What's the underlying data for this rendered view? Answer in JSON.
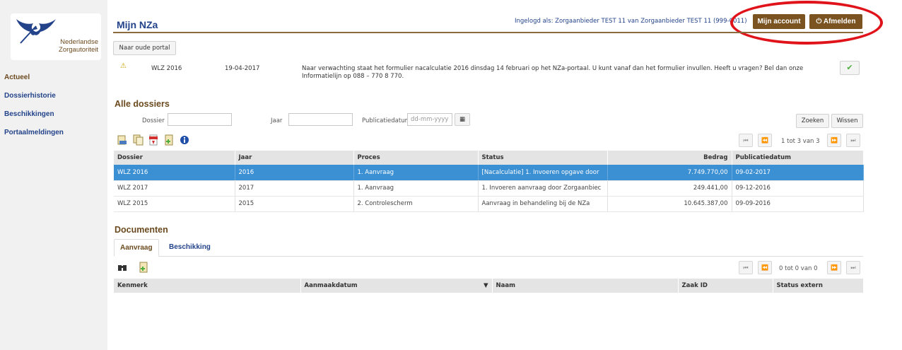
{
  "brand": {
    "line1": "Nederlandse",
    "line2": "Zorgautoriteit"
  },
  "sidebar": {
    "items": [
      {
        "label": "Actueel"
      },
      {
        "label": "Dossierhistorie"
      },
      {
        "label": "Beschikkingen"
      },
      {
        "label": "Portaalmeldingen"
      }
    ]
  },
  "header": {
    "title": "Mijn NZa",
    "logged_in": "Ingelogd als: Zorgaanbieder TEST 11 van Zorgaanbieder TEST 11 (999-0011)",
    "account_label": "Mijn account",
    "logout_label": "Afmelden",
    "old_portal_label": "Naar oude portal"
  },
  "notice": {
    "dossier": "WLZ 2016",
    "date": "19-04-2017",
    "text": "Naar verwachting staat het formulier nacalculatie 2016 dinsdag 14 februari op het NZa-portaal. U kunt vanaf dan het formulier invullen. Heeft u vragen? Bel dan onze Informatielijn op 088 – 770 8 770."
  },
  "dossiers": {
    "title": "Alle dossiers",
    "filters": {
      "dossier_label": "Dossier",
      "year_label": "Jaar",
      "pubdate_label": "Publicatiedatum",
      "pubdate_placeholder": "dd-mm-yyyy"
    },
    "search_label": "Zoeken",
    "clear_label": "Wissen",
    "pager_text": "1 tot 3 van 3",
    "columns": [
      "Dossier",
      "Jaar",
      "Proces",
      "Status",
      "Bedrag",
      "Publicatiedatum"
    ],
    "rows": [
      [
        "WLZ 2016",
        "2016",
        "1. Aanvraag",
        "[Nacalculatie] 1. Invoeren opgave door",
        "7.749.770,00",
        "09-02-2017"
      ],
      [
        "WLZ 2017",
        "2017",
        "1. Aanvraag",
        "1. Invoeren aanvraag door Zorgaanbiec",
        "249.441,00",
        "09-12-2016"
      ],
      [
        "WLZ 2015",
        "2015",
        "2. Controlescherm",
        "Aanvraag in behandeling bij de NZa",
        "10.645.387,00",
        "09-09-2016"
      ]
    ]
  },
  "documents": {
    "title": "Documenten",
    "tabs": [
      {
        "label": "Aanvraag"
      },
      {
        "label": "Beschikking"
      }
    ],
    "pager_text": "0 tot 0 van 0",
    "columns": [
      "Kenmerk",
      "Aanmaakdatum",
      "Naam",
      "Zaak ID",
      "Status extern"
    ],
    "sort_indicator": "▼"
  },
  "colors": {
    "brand_brown": "#7a5320",
    "link_blue": "#23438a",
    "selection_blue": "#3b8fd3",
    "highlight_red": "#e0121a"
  }
}
